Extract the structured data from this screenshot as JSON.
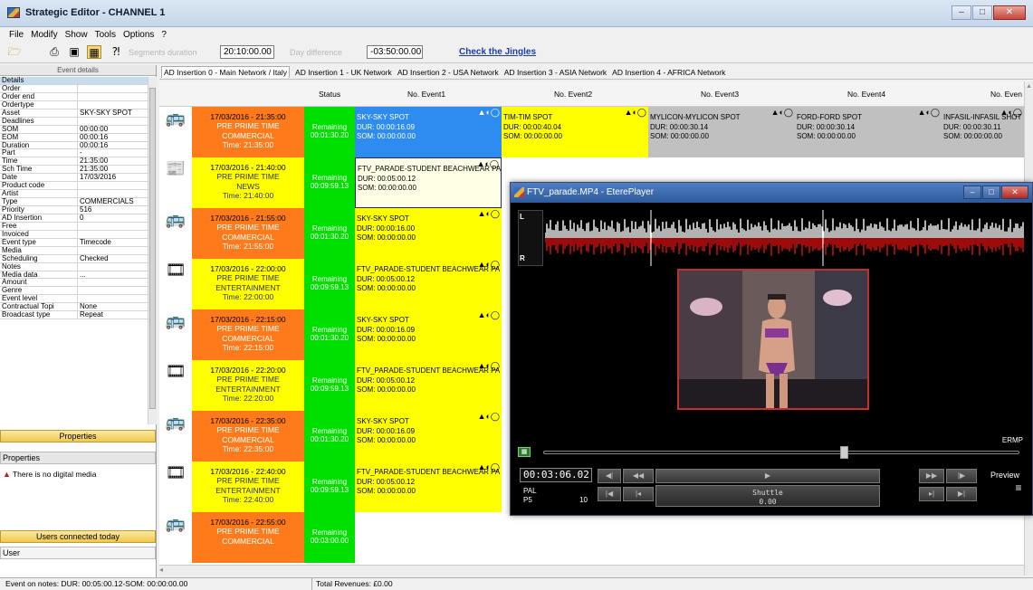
{
  "window": {
    "title": "Strategic Editor - CHANNEL 1"
  },
  "menu": [
    "File",
    "Modify",
    "Show",
    "Tools",
    "Options",
    "?"
  ],
  "toolbar": {
    "segments_label": "Segments duration",
    "segments_value": "20:10:00.00",
    "day_diff_label": "Day difference",
    "day_diff_value": "-03:50:00.00",
    "jingles_link": "Check the Jingles"
  },
  "left_panel": {
    "header": "Event details",
    "properties": [
      [
        "Details",
        ""
      ],
      [
        "Order",
        ""
      ],
      [
        "Order end",
        ""
      ],
      [
        "Ordertype",
        ""
      ],
      [
        "Asset",
        "SKY-SKY SPOT"
      ],
      [
        "Deadlines",
        ""
      ],
      [
        "SOM",
        "00:00:00"
      ],
      [
        "EOM",
        "00:00:16"
      ],
      [
        "Duration",
        "00:00:16"
      ],
      [
        "Part",
        "-"
      ],
      [
        "Time",
        "21:35:00"
      ],
      [
        "Sch Time",
        "21:35:00"
      ],
      [
        "Date",
        "17/03/2016"
      ],
      [
        "Product code",
        ""
      ],
      [
        "Artist",
        ""
      ],
      [
        "Type",
        "COMMERCIALS"
      ],
      [
        "Priority",
        "516"
      ],
      [
        "AD Insertion",
        "0"
      ],
      [
        "Free",
        ""
      ],
      [
        "Invoiced",
        ""
      ],
      [
        "Event type",
        "Timecode"
      ],
      [
        "Media",
        ""
      ],
      [
        "Scheduling",
        "Checked"
      ],
      [
        "Notes",
        ""
      ],
      [
        "Media data",
        "..."
      ],
      [
        "Amount",
        ""
      ],
      [
        "Genre",
        ""
      ],
      [
        "Event level",
        ""
      ],
      [
        "Contractual Topi",
        "None"
      ],
      [
        "Broadcast type",
        "Repeat"
      ]
    ],
    "properties_button": "Properties",
    "properties_section": "Properties",
    "no_media": "There is no digital media",
    "users_button": "Users connected today",
    "user_section": "User"
  },
  "tabs": [
    "AD Insertion 0 - Main Network / Italy",
    "AD Insertion 1 - UK Network",
    "AD Insertion 2 - USA Network",
    "AD Insertion 3 - ASIA Network",
    "AD Insertion 4 - AFRICA Network"
  ],
  "columns": [
    "Status",
    "No. Event1",
    "No. Event2",
    "No. Event3",
    "No. Event4",
    "No. Even"
  ],
  "rows": [
    {
      "icon": "bus",
      "date": "17/03/2016 - 21:35:00",
      "slot": "PRE PRIME TIME",
      "cat": "COMMERCIAL",
      "time": "Time: 21:35:00",
      "color": "#ff7a1a",
      "status_label": "Remaining",
      "status_time": "00:01:30.20",
      "ev1": {
        "name": "SKY-SKY SPOT",
        "dur": "DUR: 00:00:16.09",
        "som": "SOM: 00:00:00.00",
        "bg": "#2e8bf0",
        "fg": "#fff"
      },
      "ev2": {
        "name": "TIM-TIM SPOT",
        "dur": "DUR: 00:00:40.04",
        "som": "SOM: 00:00:00.00",
        "bg": "#ffff00",
        "fg": "#000"
      },
      "ev3": {
        "name": "MYLICON-MYLICON SPOT",
        "dur": "DUR: 00:00:30.14",
        "som": "SOM: 00:00:00.00",
        "bg": "#c0c0c0",
        "fg": "#000"
      },
      "ev4": {
        "name": "FORD-FORD SPOT",
        "dur": "DUR: 00:00:30.14",
        "som": "SOM: 00:00:00.00",
        "bg": "#c0c0c0",
        "fg": "#000"
      },
      "ev5": {
        "name": "INFASIL-INFASIL SHOT",
        "dur": "DUR: 00:00:30.11",
        "som": "SOM: 00:00:00.00",
        "bg": "#c0c0c0",
        "fg": "#000"
      }
    },
    {
      "icon": "news",
      "date": "17/03/2016 - 21:40:00",
      "slot": "PRE PRIME TIME",
      "cat": "NEWS",
      "time": "Time: 21:40:00",
      "color": "#ffff00",
      "status_label": "Remaining",
      "status_time": "00:09:59.13",
      "ev1": {
        "name": "FTV_PARADE-STUDENT BEACHWEAR PA",
        "dur": "DUR: 00:05:00.12",
        "som": "SOM: 00:00:00.00",
        "bg": "#ffffe6",
        "fg": "#000"
      }
    },
    {
      "icon": "bus",
      "date": "17/03/2016 - 21:55:00",
      "slot": "PRE PRIME TIME",
      "cat": "COMMERCIAL",
      "time": "Time: 21:55:00",
      "color": "#ff7a1a",
      "status_label": "Remaining",
      "status_time": "00:01:30.20",
      "ev1": {
        "name": "SKY-SKY SPOT",
        "dur": "DUR: 00:00:16.00",
        "som": "SOM: 00:00:00.00",
        "bg": "#ffff00",
        "fg": "#000"
      }
    },
    {
      "icon": "film",
      "date": "17/03/2016 - 22:00:00",
      "slot": "PRE PRIME TIME",
      "cat": "ENTERTAINMENT",
      "time": "Time: 22:00:00",
      "color": "#ffff00",
      "status_label": "Remaining",
      "status_time": "00:09:59.13",
      "ev1": {
        "name": "FTV_PARADE-STUDENT BEACHWEAR PA",
        "dur": "DUR: 00:05:00.12",
        "som": "SOM: 00:00:00.00",
        "bg": "#ffff00",
        "fg": "#000"
      }
    },
    {
      "icon": "bus",
      "date": "17/03/2016 - 22:15:00",
      "slot": "PRE PRIME TIME",
      "cat": "COMMERCIAL",
      "time": "Time: 22:15:00",
      "color": "#ff7a1a",
      "status_label": "Remaining",
      "status_time": "00:01:30.20",
      "ev1": {
        "name": "SKY-SKY SPOT",
        "dur": "DUR: 00:00:16.09",
        "som": "SOM: 00:00:00.00",
        "bg": "#ffff00",
        "fg": "#000"
      }
    },
    {
      "icon": "film",
      "date": "17/03/2016 - 22:20:00",
      "slot": "PRE PRIME TIME",
      "cat": "ENTERTAINMENT",
      "time": "Time: 22:20:00",
      "color": "#ffff00",
      "status_label": "Remaining",
      "status_time": "00:09:59.13",
      "ev1": {
        "name": "FTV_PARADE-STUDENT BEACHWEAR PA",
        "dur": "DUR: 00:05:00.12",
        "som": "SOM: 00:00:00.00",
        "bg": "#ffff00",
        "fg": "#000"
      }
    },
    {
      "icon": "bus",
      "date": "17/03/2016 - 22:35:00",
      "slot": "PRE PRIME TIME",
      "cat": "COMMERCIAL",
      "time": "Time: 22:35:00",
      "color": "#ff7a1a",
      "status_label": "Remaining",
      "status_time": "00:01:30.20",
      "ev1": {
        "name": "SKY-SKY SPOT",
        "dur": "DUR: 00:00:16.09",
        "som": "SOM: 00:00:00.00",
        "bg": "#ffff00",
        "fg": "#000"
      }
    },
    {
      "icon": "film",
      "date": "17/03/2016 - 22:40:00",
      "slot": "PRE PRIME TIME",
      "cat": "ENTERTAINMENT",
      "time": "Time: 22:40:00",
      "color": "#ffff00",
      "status_label": "Remaining",
      "status_time": "00:09:59.13",
      "ev1": {
        "name": "FTV_PARADE-STUDENT BEACHWEAR PA",
        "dur": "DUR: 00:05:00.12",
        "som": "SOM: 00:00:00.00",
        "bg": "#ffff00",
        "fg": "#000"
      }
    },
    {
      "icon": "bus",
      "date": "17/03/2016 - 22:55:00",
      "slot": "PRE PRIME TIME",
      "cat": "COMMERCIAL",
      "time": "",
      "color": "#ff7a1a",
      "status_label": "Remaining",
      "status_time": "00:03:00.00"
    }
  ],
  "statusbar": {
    "notes": "Event on notes: DUR: 00:05:00.12-SOM: 00:00:00.00",
    "revenues": "Total Revenues: £0.00"
  },
  "player": {
    "title": "FTV_parade.MP4 - EterePlayer",
    "brand": "ERMP",
    "timecode": "00:03:06.02",
    "standard": "PAL",
    "field": "P5",
    "field_num": "10",
    "preview": "Preview",
    "shuttle_label": "Shuttle",
    "shuttle_value": "0.00"
  }
}
